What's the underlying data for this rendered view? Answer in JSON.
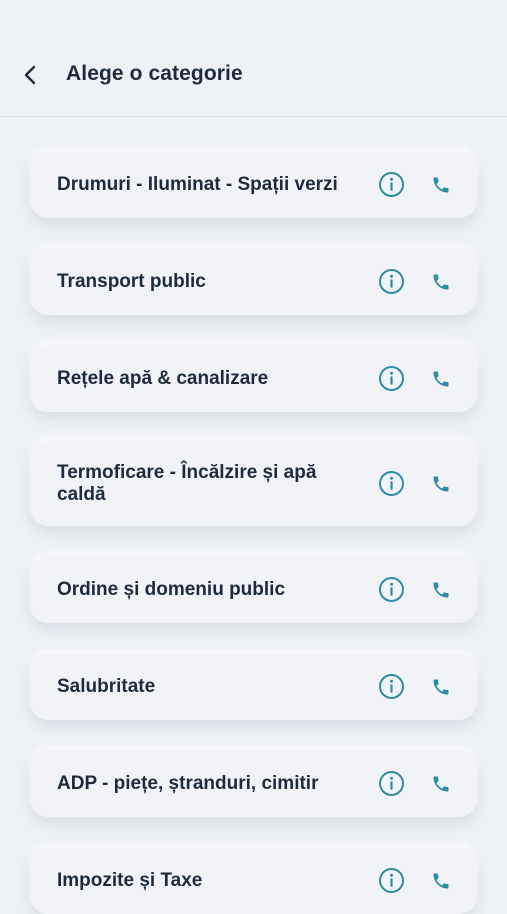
{
  "header": {
    "back_icon": "chevron-left-icon",
    "title": "Alege o categorie"
  },
  "accent_color": "#2e8ca3",
  "categories": [
    {
      "label": "Drumuri - Iluminat - Spații verzi",
      "info_icon": "info-icon",
      "phone_icon": "phone-icon"
    },
    {
      "label": "Transport public",
      "info_icon": "info-icon",
      "phone_icon": "phone-icon"
    },
    {
      "label": "Rețele apă & canalizare",
      "info_icon": "info-icon",
      "phone_icon": "phone-icon"
    },
    {
      "label": "Termoficare - Încălzire și apă caldă",
      "info_icon": "info-icon",
      "phone_icon": "phone-icon"
    },
    {
      "label": "Ordine și domeniu public",
      "info_icon": "info-icon",
      "phone_icon": "phone-icon"
    },
    {
      "label": "Salubritate",
      "info_icon": "info-icon",
      "phone_icon": "phone-icon"
    },
    {
      "label": "ADP - piețe, ștranduri, cimitir",
      "info_icon": "info-icon",
      "phone_icon": "phone-icon"
    },
    {
      "label": "Impozite și Taxe",
      "info_icon": "info-icon",
      "phone_icon": "phone-icon"
    }
  ]
}
